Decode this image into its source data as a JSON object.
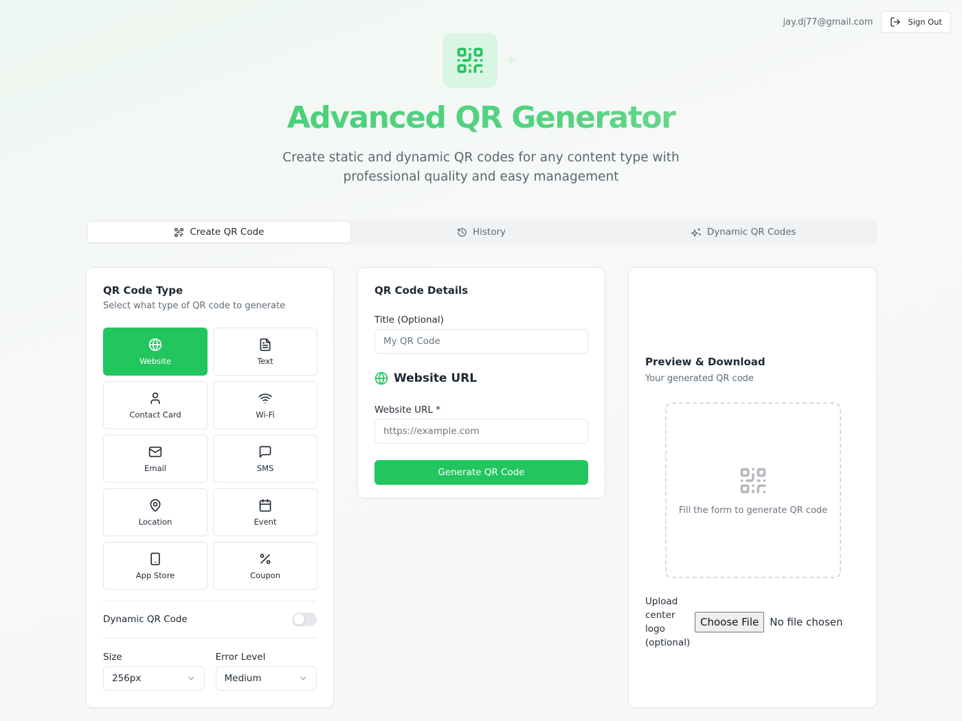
{
  "account": {
    "email": "jay.dj77@gmail.com",
    "sign_out_label": "Sign Out"
  },
  "hero": {
    "title": "Advanced QR Generator",
    "subtitle": "Create static and dynamic QR codes for any content type with professional quality and easy management"
  },
  "tabs": [
    {
      "label": "Create QR Code",
      "icon": "qr-code-icon",
      "active": true
    },
    {
      "label": "History",
      "icon": "history-icon",
      "active": false
    },
    {
      "label": "Dynamic QR Codes",
      "icon": "sparkles-icon",
      "active": false
    }
  ],
  "qr_type": {
    "title": "QR Code Type",
    "description": "Select what type of QR code to generate",
    "types": [
      {
        "label": "Website",
        "icon": "globe-icon",
        "active": true
      },
      {
        "label": "Text",
        "icon": "file-text-icon",
        "active": false
      },
      {
        "label": "Contact Card",
        "icon": "user-icon",
        "active": false
      },
      {
        "label": "Wi-Fi",
        "icon": "wifi-icon",
        "active": false
      },
      {
        "label": "Email",
        "icon": "mail-icon",
        "active": false
      },
      {
        "label": "SMS",
        "icon": "message-icon",
        "active": false
      },
      {
        "label": "Location",
        "icon": "map-pin-icon",
        "active": false
      },
      {
        "label": "Event",
        "icon": "calendar-icon",
        "active": false
      },
      {
        "label": "App Store",
        "icon": "smartphone-icon",
        "active": false
      },
      {
        "label": "Coupon",
        "icon": "percent-icon",
        "active": false
      }
    ],
    "dynamic_label": "Dynamic QR Code",
    "size_label": "Size",
    "size_value": "256px",
    "error_label": "Error Level",
    "error_value": "Medium"
  },
  "details": {
    "title": "QR Code Details",
    "title_field_label": "Title (Optional)",
    "title_placeholder": "My QR Code",
    "section_title": "Website URL",
    "url_label": "Website URL *",
    "url_placeholder": "https://example.com",
    "generate_label": "Generate QR Code"
  },
  "preview": {
    "title": "Preview & Download",
    "description": "Your generated QR code",
    "empty_message": "Fill the form to generate QR code",
    "upload_label": "Upload center logo (optional)",
    "choose_file_label": "Choose File",
    "file_status": "No file chosen"
  },
  "colors": {
    "accent": "#22c55e",
    "hero_icon_bg": "#d9f5e3"
  }
}
